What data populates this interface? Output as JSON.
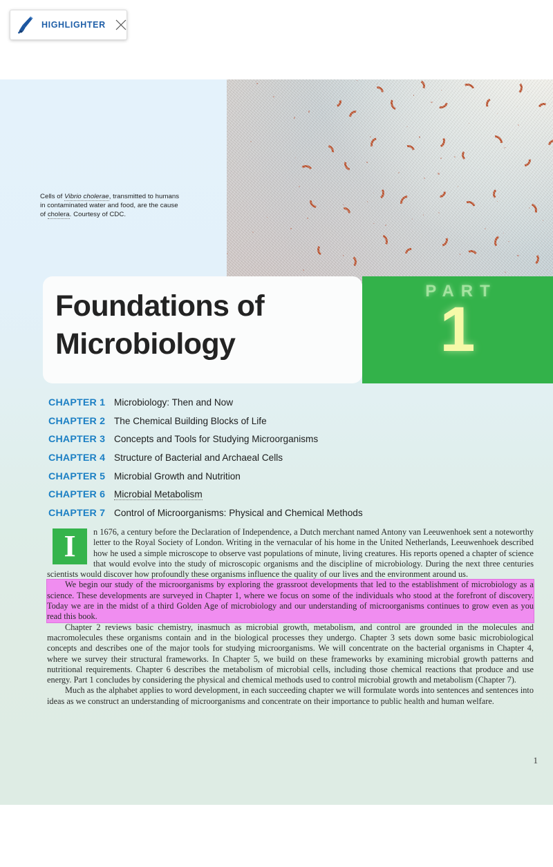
{
  "toolbar": {
    "label": "HIGHLIGHTER",
    "marker_icon": "marker-pen-icon",
    "close_icon": "close-x-icon",
    "accent_color": "#1f5fa8"
  },
  "page": {
    "number": "1",
    "background_top_color": "#e4f2fb",
    "background_bottom_color": "#deece4"
  },
  "photo": {
    "name": "vibrio-cholerae-micrograph",
    "caption_line1_prefix": "Cells of ",
    "caption_species": "Vibrio cholerae",
    "caption_line1_suffix": ", transmitted to",
    "caption_line2": "humans in contaminated water and food,",
    "caption_line3_prefix": "are the cause of ",
    "caption_line3_term": "cholera",
    "caption_line3_suffix": ". Courtesy of CDC."
  },
  "title_card": {
    "line1": "Foundations of",
    "line2": "Microbiology"
  },
  "part_badge": {
    "word": "PART",
    "number": "1",
    "green": "#33b24a",
    "number_color": "#f6f9a8"
  },
  "chapters": [
    {
      "num": "CHAPTER 1",
      "title": "Microbiology: Then and Now"
    },
    {
      "num": "CHAPTER 2",
      "title": "The Chemical Building Blocks of Life"
    },
    {
      "num": "CHAPTER 3",
      "title": "Concepts and Tools for Studying Microorganisms"
    },
    {
      "num": "CHAPTER 4",
      "title": "Structure of Bacterial and Archaeal Cells"
    },
    {
      "num": "CHAPTER 5",
      "title": "Microbial Growth and Nutrition"
    },
    {
      "num": "CHAPTER 6",
      "title": "Microbial Metabolism"
    },
    {
      "num": "CHAPTER 7",
      "title": "Control of Microorganisms: Physical and Chemical Methods"
    }
  ],
  "body": {
    "dropcap": "I",
    "para1": "n 1676, a century before the Declaration of Independence, a Dutch merchant named Antony van Leeuwenhoek sent a noteworthy letter to the Royal Society of London. Writing in the vernacular of his home in the United Netherlands, Leeuwenhoek described how he used a simple microscope to observe vast populations of minute, living creatures. His reports opened a chapter of science that would evolve into the study of microscopic organisms and the discipline of microbiology. During the next three centuries scientists would discover how profoundly these organisms influence the quality of our lives and the environment around us.",
    "para2_highlighted": "We begin our study of the microorganisms by exploring the grassroot developments that led to the establishment of microbiology as a science. These developments are surveyed in Chapter 1, where we focus on some of the individuals who stood at the forefront of discovery. Today we are in the midst of a third Golden Age of microbiology and our understanding of microorganisms continues to grow even as you read this book.",
    "para3": "Chapter 2 reviews basic chemistry, inasmuch as microbial growth, metabolism, and control are grounded in the molecules and macromolecules these organisms contain and in the biological processes they undergo. Chapter 3 sets down some basic microbiological concepts and describes one of the major tools for studying microorganisms. We will concentrate on the bacterial organisms in Chapter 4, where we survey their structural frameworks. In Chapter 5, we build on these frameworks by examining microbial growth patterns and nutritional requirements. Chapter 6 describes the metabolism of microbial cells, including those chemical reactions that produce and use energy. Part 1 concludes by considering the physical and chemical methods used to control microbial growth and metabolism (Chapter 7).",
    "para4": "Much as the alphabet applies to word development, in each succeeding chapter we will formulate words into sentences and sentences into ideas as we construct an understanding of microorganisms and concentrate on their importance to public health and human welfare.",
    "highlight_color": "#f08df0"
  }
}
